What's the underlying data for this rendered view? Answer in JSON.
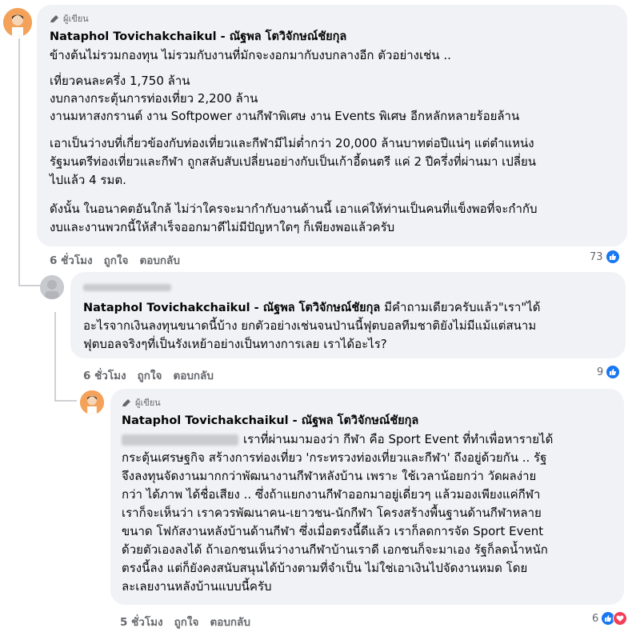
{
  "author_badge": "ผู้เขียน",
  "comments": [
    {
      "name": "Nataphol Tovichakchaikul - ณัฐพล โตวิจักษณ์ชัยกุล",
      "lines": [
        "ข้างต้นไม่รวมกองทุน ไม่รวมกับงานที่มักจะงอกมากับงบกลางอีก ตัวอย่างเช่น ..",
        "เที่ยวคนละครึ่ง 1,750 ล้าน",
        "งบกลางกระตุ้นการท่องเที่ยว 2,200 ล้าน",
        "งานมหาสงกรานต์ งาน Softpower งานกีฬาพิเศษ งาน Events พิเศษ อีกหลักหลายร้อยล้าน",
        "เอาเป็นว่างบที่เกี่ยวข้องกับท่องเที่ยวและกีฬามีไม่ต่ำกว่า 20,000 ล้านบาทต่อปีแน่ๆ แต่ตำแหน่ง",
        "รัฐมนตรีท่องเที่ยวและกีฬา ถูกสลับสับเปลี่ยนอย่างกับเป็นเก้าอี้ดนตรี แค่ 2 ปีครึ่งที่ผ่านมา เปลี่ยน",
        "ไปแล้ว 4 รมต.",
        "ดังนั้น ในอนาคตอันใกล้ ไม่ว่าใครจะมากำกับงานด้านนี้ เอาแค่ให้ท่านเป็นคนที่แข็งพอที่จะกำกับ",
        "งบและงานพวกนี้ให้สำเร็จออกมาดีไม่มีปัญหาใดๆ ก็เพียงพอแล้วครับ"
      ],
      "time": "6 ชั่วโมง",
      "like": "ถูกใจ",
      "reply": "ตอบกลับ",
      "reactions": "73"
    },
    {
      "name": "Nataphol Tovichakchaikul - ณัฐพล โตวิจักษณ์ชัยกุล",
      "first_line_rest": "มีคำถามเดียวครับแล้ว\"เรา\"ได้",
      "lines": [
        "อะไรจากเงินลงทุนขนาดนี้บ้าง ยกตัวอย่างเช่นจนป่านนี้ฟุตบอลทีมชาติยังไม่มีแม้แต่สนาม",
        "ฟุตบอลจริงๆที่เป็นรังเหย้าอย่างเป็นทางการเลย เราได้อะไร?"
      ],
      "time": "6 ชั่วโมง",
      "like": "ถูกใจ",
      "reply": "ตอบกลับ",
      "reactions": "9"
    },
    {
      "name": "Nataphol Tovichakchaikul - ณัฐพล โตวิจักษณ์ชัยกุล",
      "first_line_rest": "เราที่ผ่านมามองว่า กีฬา คือ Sport Event ที่ทำเพื่อหารายได้",
      "lines": [
        "กระตุ้นเศรษฐกิจ สร้างการท่องเที่ยว 'กระทรวงท่องเที่ยวและกีฬา' ถึงอยู่ด้วยกัน .. รัฐ",
        "จึงลงทุนจัดงานมากกว่าพัฒนางานกีฬาหลังบ้าน เพราะ ใช้เวลาน้อยกว่า วัดผลง่าย",
        "กว่า ได้ภาพ ได้ชื่อเสียง .. ซึ่งถ้าแยกงานกีฬาออกมาอยู่เดี่ยวๆ แล้วมองเพียงแค่กีฬา",
        "เราก็จะเห็นว่า เราควรพัฒนาคน-เยาวชน-นักกีฬา โครงสร้างพื้นฐานด้านกีฬาหลาย",
        "ขนาด โฟกัสงานหลังบ้านด้านกีฬา ซึ่งเมื่อตรงนี้ดีแล้ว เราก็ลดการจัด Sport Event",
        "ด้วยตัวเองลงได้ ถ้าเอกชนเห็นว่างานกีฬาบ้านเราดี เอกชนก็จะมาเอง รัฐก็ลดน้ำหนัก",
        "ตรงนี้ลง แต่ก็ยังคงสนับสนุนได้บ้างตามที่จำเป็น ไม่ใช่เอาเงินไปจัดงานหมด โดย",
        "ละเลยงานหลังบ้านแบบนี้ครับ"
      ],
      "time": "5 ชั่วโมง",
      "like": "ถูกใจ",
      "reply": "ตอบกลับ",
      "reactions": "6"
    }
  ],
  "colors": {
    "accent": "#1877f2",
    "bubble": "#f0f2f5",
    "muted": "#65676b",
    "heart": "#f33e58"
  }
}
